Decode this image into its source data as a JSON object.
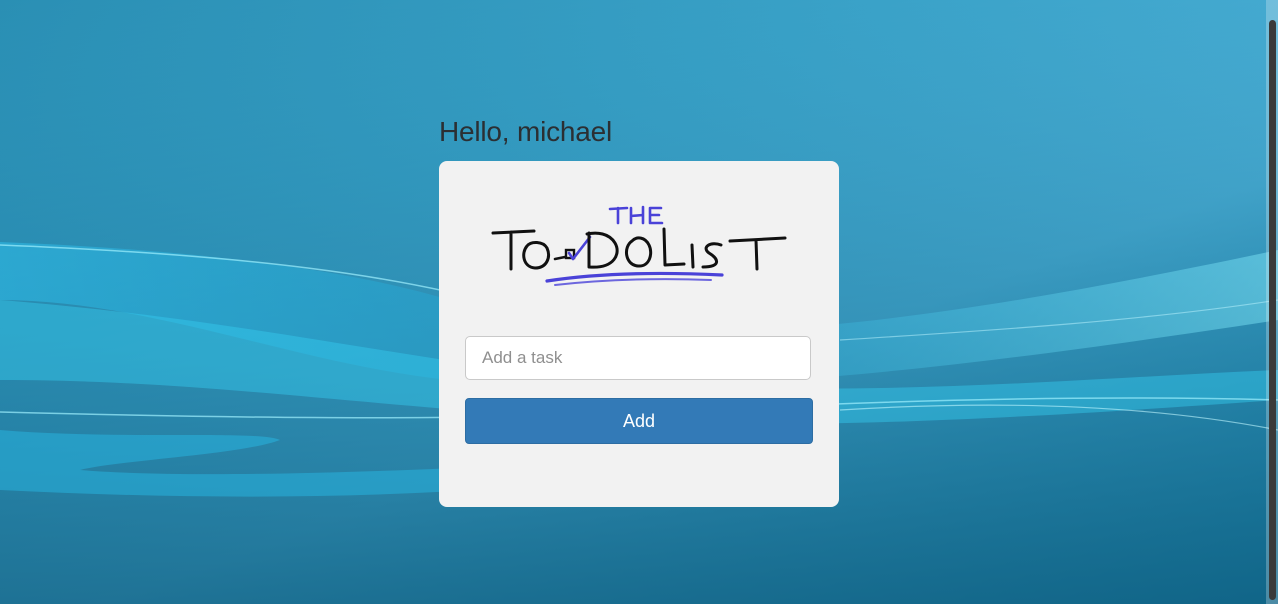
{
  "greeting": "Hello, michael",
  "logo": {
    "text_top": "THE",
    "text_main": "TO-DO LIST"
  },
  "task_input": {
    "value": "",
    "placeholder": "Add a task"
  },
  "add_button": {
    "label": "Add"
  },
  "colors": {
    "button": "#337ab7",
    "card": "#f2f2f2",
    "logo_accent": "#4a42d8"
  }
}
